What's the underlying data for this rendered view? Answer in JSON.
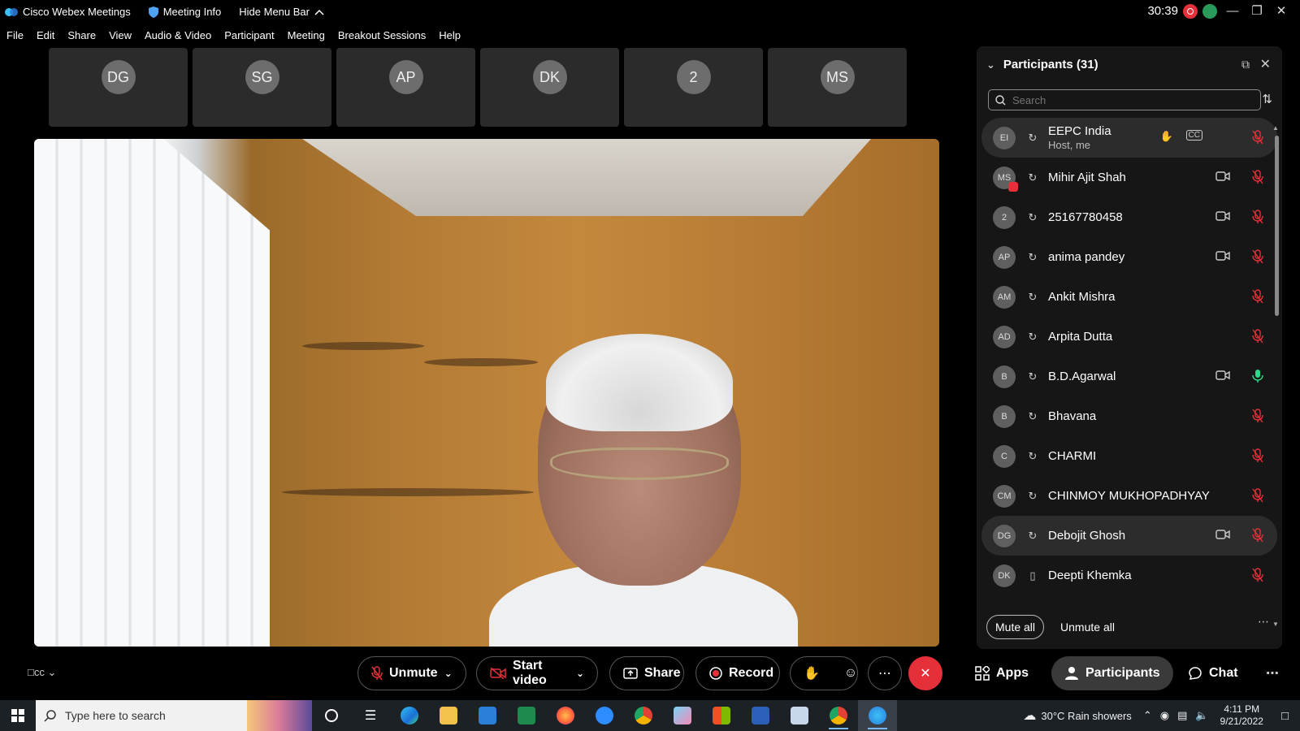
{
  "titlebar": {
    "app_title": "Cisco Webex Meetings",
    "meeting_info": "Meeting Info",
    "hide_menu": "Hide Menu Bar",
    "timer": "30:39"
  },
  "menu": [
    "File",
    "Edit",
    "Share",
    "View",
    "Audio & Video",
    "Participant",
    "Meeting",
    "Breakout Sessions",
    "Help"
  ],
  "thumbnails": [
    "DG",
    "SG",
    "AP",
    "DK",
    "2",
    "MS"
  ],
  "panel": {
    "title": "Participants (31)",
    "search_placeholder": "Search",
    "mute_all": "Mute all",
    "unmute_all": "Unmute all",
    "participants": [
      {
        "initials": "EI",
        "name": "EEPC India",
        "sub": "Host, me",
        "video": false,
        "mic": "muted",
        "host": true
      },
      {
        "initials": "MS",
        "name": "Mihir Ajit Shah",
        "video": true,
        "mic": "muted"
      },
      {
        "initials": "2",
        "name": "25167780458",
        "video": true,
        "mic": "muted"
      },
      {
        "initials": "AP",
        "name": "anima pandey",
        "video": true,
        "mic": "muted"
      },
      {
        "initials": "AM",
        "name": "Ankit Mishra",
        "video": false,
        "mic": "muted"
      },
      {
        "initials": "AD",
        "name": "Arpita Dutta",
        "video": false,
        "mic": "muted"
      },
      {
        "initials": "B",
        "name": "B.D.Agarwal",
        "video": true,
        "mic": "on"
      },
      {
        "initials": "B",
        "name": "Bhavana",
        "video": false,
        "mic": "muted"
      },
      {
        "initials": "C",
        "name": "CHARMI",
        "video": false,
        "mic": "muted"
      },
      {
        "initials": "CM",
        "name": "CHINMOY MUKHOPADHYAY",
        "video": false,
        "mic": "muted"
      },
      {
        "initials": "DG",
        "name": "Debojit Ghosh",
        "video": true,
        "mic": "muted",
        "highlight": true
      },
      {
        "initials": "DK",
        "name": "Deepti Khemka",
        "video": false,
        "mic": "muted",
        "phone": true
      }
    ]
  },
  "controls": {
    "unmute": "Unmute",
    "start_video": "Start video",
    "share": "Share",
    "record": "Record",
    "apps": "Apps",
    "participants": "Participants",
    "chat": "Chat"
  },
  "taskbar": {
    "search_placeholder": "Type here to search",
    "weather": "30°C  Rain showers",
    "time": "4:11 PM",
    "date": "9/21/2022"
  },
  "colors": {
    "accent_red": "#e5303a",
    "panel_bg": "#161616",
    "mic_on": "#2bd98a"
  }
}
